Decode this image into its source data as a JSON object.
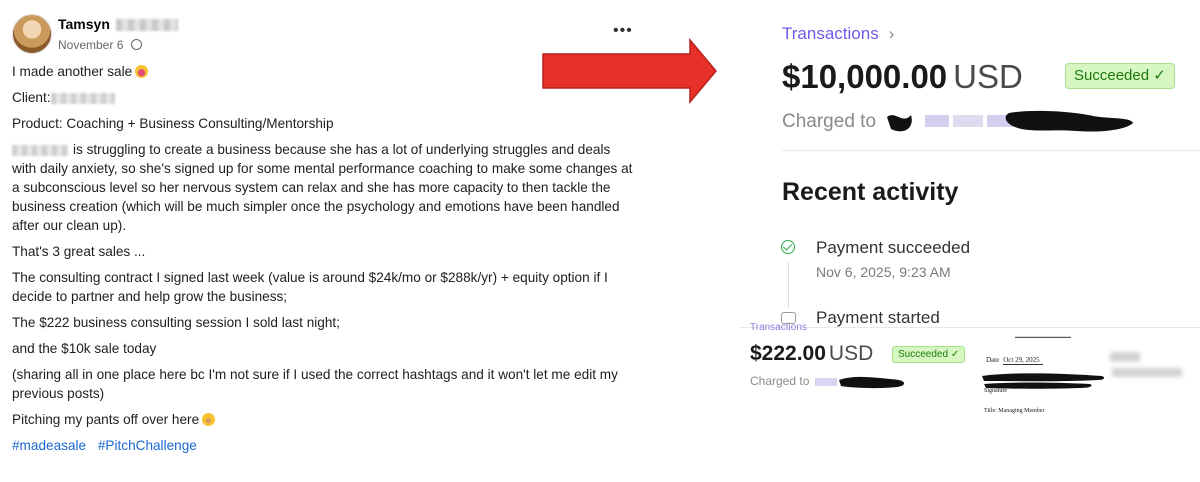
{
  "post": {
    "author": "Tamsyn",
    "date": "November 6",
    "more_label": "•••",
    "line_intro": "I made another sale",
    "client_label": "Client:",
    "product": "Product: Coaching + Business Consulting/Mentorship",
    "story": "is struggling to create a business because she has a lot of underlying struggles and deals with daily anxiety, so she's signed up for some mental performance coaching to make some changes at a subconscious level so her nervous system can relax and she has more capacity to then tackle the business creation (which will be much simpler once the psychology and emotions have been handled after our clean up).",
    "summary": "That's 3 great sales ...",
    "sale1": "The consulting contract I signed last week (value is around $24k/mo or $288k/yr) + equity option if I decide to partner and help grow the business;",
    "sale2": "The $222 business consulting session I sold last night;",
    "sale3": "and the $10k sale today",
    "note": "(sharing all in one place here bc I'm not sure if I used the correct hashtags and it won't let me edit my previous posts)",
    "closing": "Pitching my pants off over here",
    "tags": [
      "#madeasale",
      "#PitchChallenge"
    ]
  },
  "transaction": {
    "breadcrumb": "Transactions",
    "amount": "$10,000.00",
    "currency": "USD",
    "status": "Succeeded ✓",
    "charged_label": "Charged to",
    "recent_heading": "Recent activity",
    "activity": [
      {
        "label": "Payment succeeded",
        "time": "Nov 6, 2025, 9:23 AM"
      },
      {
        "label": "Payment started",
        "time": ""
      }
    ]
  },
  "transaction_small": {
    "breadcrumb": "Transactions",
    "amount": "$222.00",
    "currency": "USD",
    "status": "Succeeded ✓",
    "charged_label": "Charged to",
    "doc_date_label": "Date",
    "doc_date_value": "Oct 29, 2025",
    "doc_signature": "Signature",
    "doc_title": "Title: Managing Member"
  },
  "colors": {
    "accent": "#6c5ce7",
    "success_bg": "#d7f7c2",
    "success_text": "#1d7a0b",
    "arrow": "#e8302a",
    "hashtag": "#1a67d2"
  }
}
